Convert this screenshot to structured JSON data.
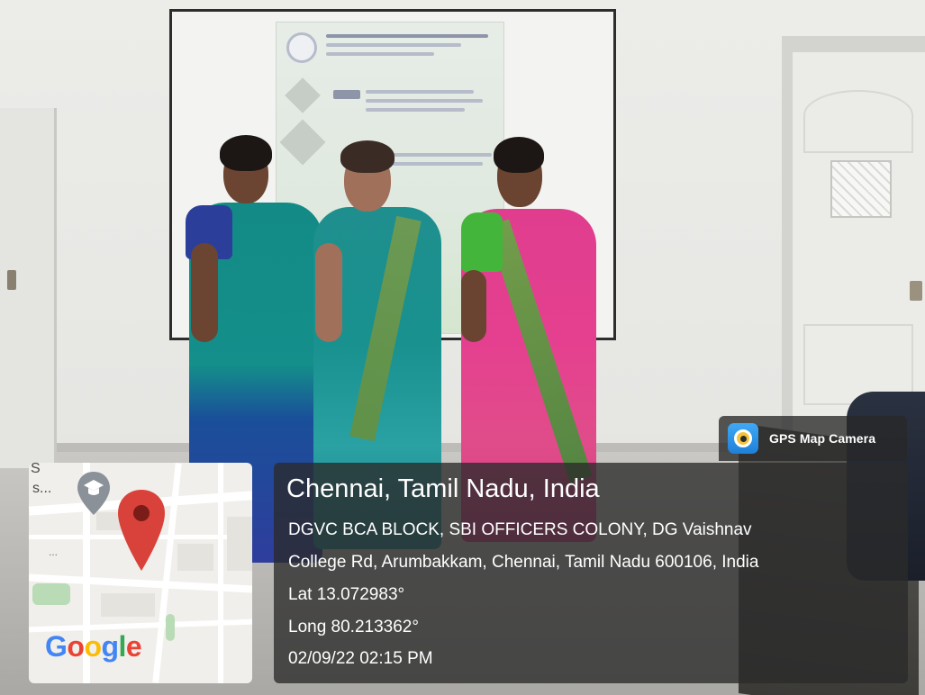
{
  "badge": {
    "label": "GPS Map Camera",
    "icon": "gps-map-camera-app-icon"
  },
  "map": {
    "top_label": "S",
    "side_label": "s...",
    "dots": "...",
    "provider": "Google",
    "provider_letters": [
      "G",
      "o",
      "o",
      "g",
      "l",
      "e"
    ],
    "provider_colors": [
      "#4285F4",
      "#EA4335",
      "#FBBC05",
      "#4285F4",
      "#34A853",
      "#EA4335"
    ],
    "pin_color": "#D9423A",
    "poi_icon": "graduation-cap-icon"
  },
  "location": {
    "title": "Chennai, Tamil Nadu, India",
    "address_line1": "DGVC BCA BLOCK, SBI OFFICERS COLONY, DG Vaishnav",
    "address_line2": "College Rd, Arumbakkam, Chennai, Tamil Nadu 600106, India",
    "latitude": "Lat 13.072983°",
    "longitude": "Long 80.213362°",
    "datetime": "02/09/22 02:15 PM"
  }
}
